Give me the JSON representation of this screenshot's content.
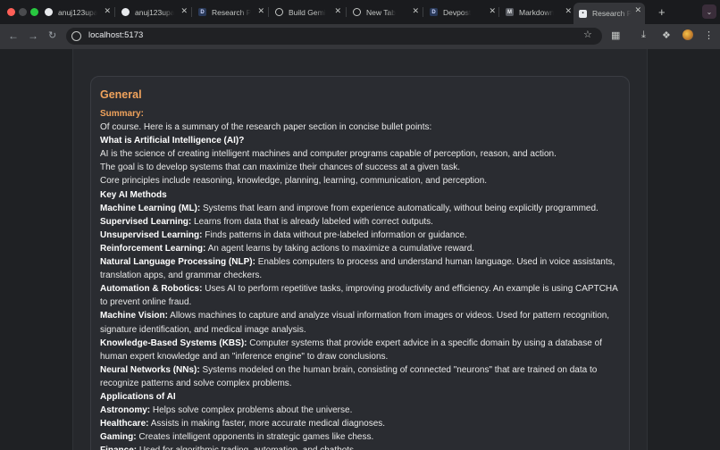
{
  "browser": {
    "tabs": [
      {
        "title": "anuj123upa",
        "icon": "github-icon"
      },
      {
        "title": "anuj123upa",
        "icon": "github-icon"
      },
      {
        "title": "Research P",
        "icon": "devpost-icon"
      },
      {
        "title": "Build Gemi",
        "icon": "globe-icon"
      },
      {
        "title": "New Tab",
        "icon": "chrome-icon"
      },
      {
        "title": "Devpost",
        "icon": "devpost-icon"
      },
      {
        "title": "Markdown",
        "icon": "markdown-icon"
      },
      {
        "title": "Research P",
        "icon": "app-icon",
        "active": true
      }
    ],
    "url": "localhost:5173"
  },
  "section": {
    "heading": "General",
    "summary_label": "Summary:",
    "intro": "Of course. Here is a summary of the research paper section in concise bullet points:",
    "blocks": [
      {
        "kind": "heading",
        "text": "What is Artificial Intelligence (AI)?"
      },
      {
        "kind": "text",
        "text": "AI is the science of creating intelligent machines and computer programs capable of perception, reason, and action."
      },
      {
        "kind": "text",
        "text": "The goal is to develop systems that can maximize their chances of success at a given task."
      },
      {
        "kind": "text",
        "text": "Core principles include reasoning, knowledge, planning, learning, communication, and perception."
      },
      {
        "kind": "heading",
        "text": "Key AI Methods"
      },
      {
        "kind": "item",
        "term": "Machine Learning (ML):",
        "text": " Systems that learn and improve from experience automatically, without being explicitly programmed."
      },
      {
        "kind": "item",
        "term": "Supervised Learning:",
        "text": " Learns from data that is already labeled with correct outputs."
      },
      {
        "kind": "item",
        "term": "Unsupervised Learning:",
        "text": " Finds patterns in data without pre-labeled information or guidance."
      },
      {
        "kind": "item",
        "term": "Reinforcement Learning:",
        "text": " An agent learns by taking actions to maximize a cumulative reward."
      },
      {
        "kind": "item",
        "term": "Natural Language Processing (NLP):",
        "text": " Enables computers to process and understand human language. Used in voice assistants, translation apps, and grammar checkers."
      },
      {
        "kind": "item",
        "term": "Automation & Robotics:",
        "text": " Uses AI to perform repetitive tasks, improving productivity and efficiency. An example is using CAPTCHA to prevent online fraud."
      },
      {
        "kind": "item",
        "term": "Machine Vision:",
        "text": " Allows machines to capture and analyze visual information from images or videos. Used for pattern recognition, signature identification, and medical image analysis."
      },
      {
        "kind": "item",
        "term": "Knowledge-Based Systems (KBS):",
        "text": " Computer systems that provide expert advice in a specific domain by using a database of human expert knowledge and an \"inference engine\" to draw conclusions."
      },
      {
        "kind": "item",
        "term": "Neural Networks (NNs):",
        "text": " Systems modeled on the human brain, consisting of connected \"neurons\" that are trained on data to recognize patterns and solve complex problems."
      },
      {
        "kind": "heading",
        "text": "Applications of AI"
      },
      {
        "kind": "item",
        "term": "Astronomy:",
        "text": " Helps solve complex problems about the universe."
      },
      {
        "kind": "item",
        "term": "Healthcare:",
        "text": " Assists in making faster, more accurate medical diagnoses."
      },
      {
        "kind": "item",
        "term": "Gaming:",
        "text": " Creates intelligent opponents in strategic games like chess."
      },
      {
        "kind": "item",
        "term": "Finance:",
        "text": " Used for algorithmic trading, automation, and chatbots."
      }
    ]
  }
}
